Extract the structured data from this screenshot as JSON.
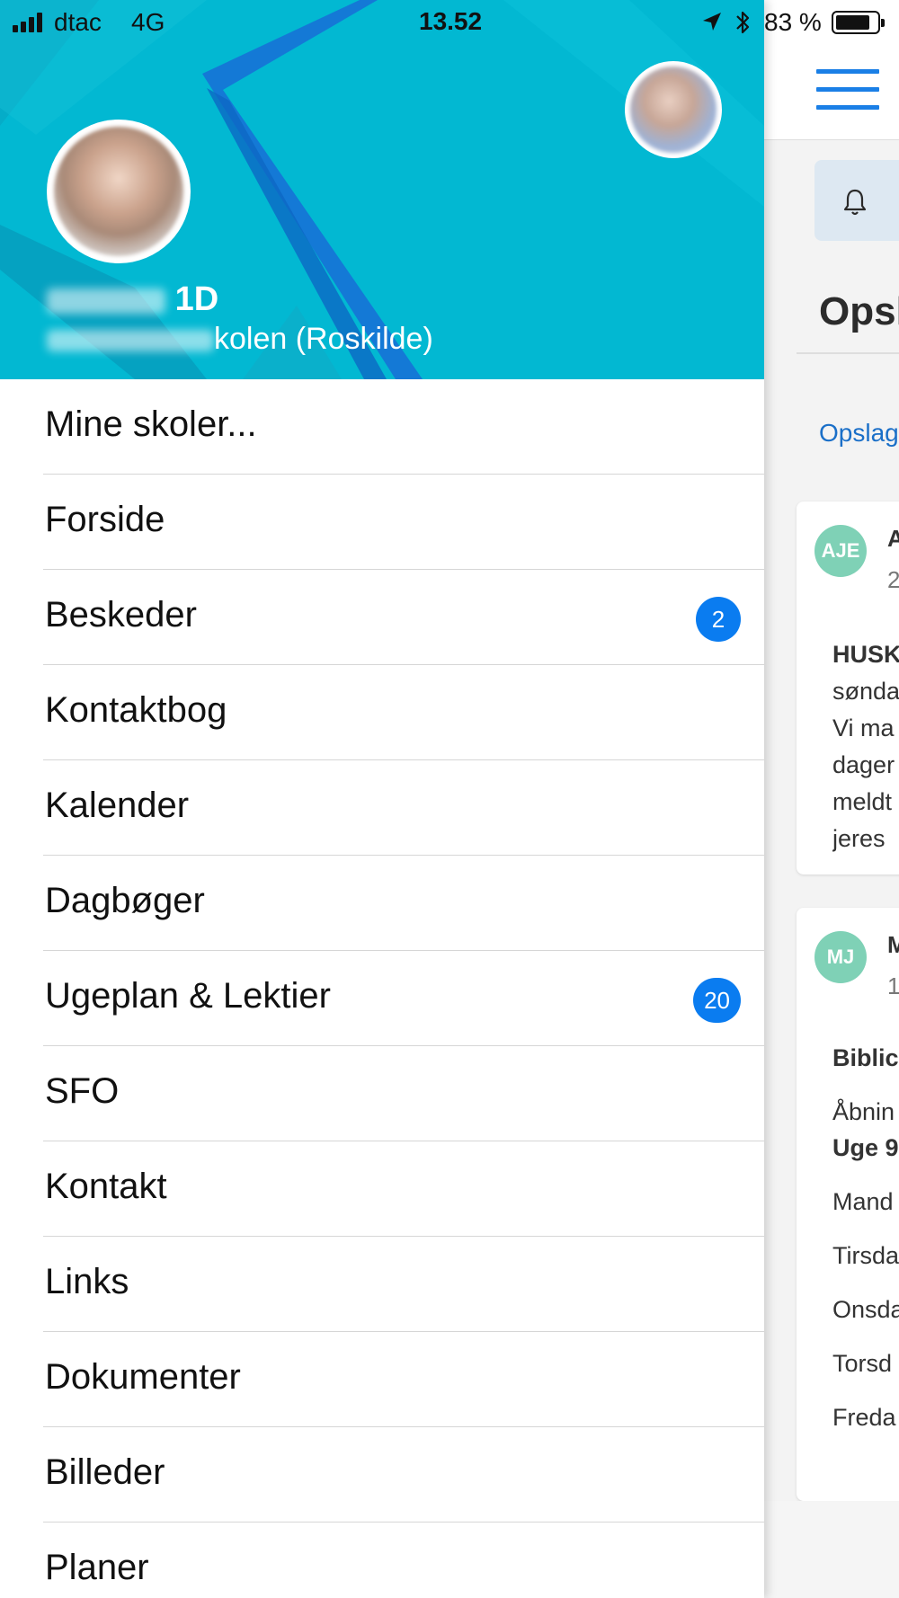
{
  "status_bar": {
    "carrier": "dtac",
    "network": "4G",
    "time": "13.52",
    "battery": "83 %",
    "battery_level": 0.83
  },
  "profile": {
    "name_visible": "1D",
    "school_visible": "kolen (Roskilde)"
  },
  "menu": {
    "items": [
      {
        "label": "Mine skoler...",
        "badge": ""
      },
      {
        "label": "Forside",
        "badge": ""
      },
      {
        "label": "Beskeder",
        "badge": "2"
      },
      {
        "label": "Kontaktbog",
        "badge": ""
      },
      {
        "label": "Kalender",
        "badge": ""
      },
      {
        "label": "Dagbøger",
        "badge": ""
      },
      {
        "label": "Ugeplan & Lektier",
        "badge": "20"
      },
      {
        "label": "SFO",
        "badge": ""
      },
      {
        "label": "Kontakt",
        "badge": ""
      },
      {
        "label": "Links",
        "badge": ""
      },
      {
        "label": "Dokumenter",
        "badge": ""
      },
      {
        "label": "Billeder",
        "badge": ""
      },
      {
        "label": "Planer",
        "badge": ""
      }
    ]
  },
  "background": {
    "title": "Opsl",
    "link": "Opslag",
    "cards": [
      {
        "initials": "AJE",
        "name": "A",
        "date": "2",
        "lines": [
          "HUSK",
          "sønda",
          "Vi ma",
          "dager",
          "meldt",
          "jeres"
        ]
      },
      {
        "initials": "MJ",
        "name": "M",
        "date": "1",
        "lines": [
          "Biblic",
          "Åbnin",
          "Uge 9",
          "Mand",
          "Tirsda",
          "Onsda",
          "Torsd",
          "Freda"
        ]
      }
    ]
  },
  "colors": {
    "header_bg": "#02b8d2",
    "badge": "#0a7cf0",
    "accent_link": "#1a6fc8",
    "avatar_green": "#7fd1b6"
  }
}
